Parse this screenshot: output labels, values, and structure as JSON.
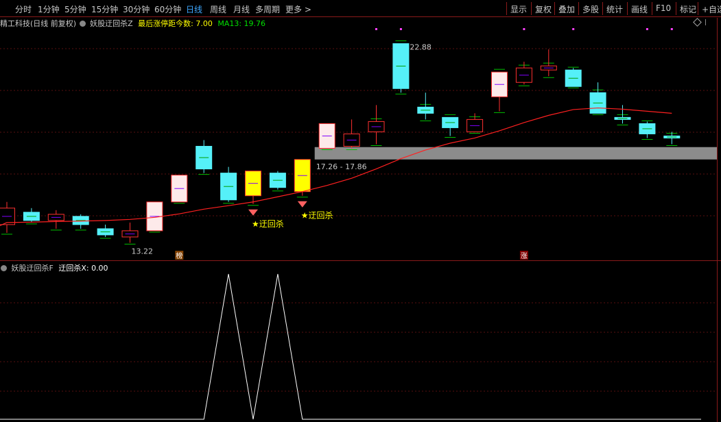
{
  "toolbar": {
    "periods": [
      "分时",
      "1分钟",
      "5分钟",
      "15分钟",
      "30分钟",
      "60分钟",
      "日线",
      "周线",
      "月线",
      "多周期",
      "更多 >"
    ],
    "active_period": "日线",
    "right_buttons": [
      "显示",
      "复权",
      "叠加",
      "多股",
      "统计",
      "画线",
      "F10",
      "标记",
      "+自选"
    ]
  },
  "main_panel": {
    "stock_title": "精工科技(日线 前复权)",
    "indicator_name": "妖股迂回杀Z",
    "last_limit_label": "最后涨停距今数: 7.00",
    "ma_label": "MA13: 19.76",
    "colors": {
      "ma13": "#ff2020",
      "indicator_name": "#c8c8c8",
      "last_limit": "#ffff00",
      "ma_label": "#00e000"
    }
  },
  "sub_panel": {
    "indicator_name": "妖股迂回杀F",
    "value_label": "迂回杀X: 0.00"
  },
  "chart_data": [
    {
      "type": "candlestick",
      "ma_name": "MA13",
      "ylim": [
        12.5,
        23.6
      ],
      "candles": [
        {
          "open": 14.1,
          "close": 14.9,
          "high": 15.2,
          "low": 13.7,
          "style": "hollow-red"
        },
        {
          "open": 14.7,
          "close": 14.3,
          "high": 14.9,
          "low": 14.2,
          "style": "cyan"
        },
        {
          "open": 14.3,
          "close": 14.6,
          "high": 14.8,
          "low": 13.9,
          "style": "hollow-red"
        },
        {
          "open": 14.5,
          "close": 14.1,
          "high": 14.6,
          "low": 13.9,
          "style": "cyan"
        },
        {
          "open": 13.9,
          "close": 13.6,
          "high": 14.1,
          "low": 13.5,
          "style": "cyan"
        },
        {
          "open": 13.5,
          "close": 13.8,
          "high": 14.2,
          "low": 13.22,
          "style": "hollow-red"
        },
        {
          "open": 13.8,
          "close": 15.2,
          "high": 15.2,
          "low": 13.8,
          "style": "pink-filled"
        },
        {
          "open": 15.2,
          "close": 16.5,
          "high": 16.5,
          "low": 15.2,
          "style": "pink-filled"
        },
        {
          "open": 17.9,
          "close": 16.8,
          "high": 18.2,
          "low": 16.6,
          "style": "cyan"
        },
        {
          "open": 16.6,
          "close": 15.3,
          "high": 16.9,
          "low": 15.2,
          "style": "cyan"
        },
        {
          "open": 15.5,
          "close": 16.7,
          "high": 16.7,
          "low": 15.1,
          "style": "yellow-filled"
        },
        {
          "open": 16.6,
          "close": 15.9,
          "high": 16.7,
          "low": 15.8,
          "style": "cyan"
        },
        {
          "open": 15.7,
          "close": 17.26,
          "high": 17.26,
          "low": 15.5,
          "style": "yellow-filled"
        },
        {
          "open": 17.8,
          "close": 19.0,
          "high": 19.0,
          "low": 17.8,
          "style": "pink-filled"
        },
        {
          "open": 17.9,
          "close": 18.5,
          "high": 19.2,
          "low": 17.8,
          "style": "hollow-red"
        },
        {
          "open": 18.6,
          "close": 19.1,
          "high": 19.9,
          "low": 18.0,
          "style": "hollow-red"
        },
        {
          "open": 20.7,
          "close": 22.88,
          "high": 22.88,
          "low": 20.5,
          "style": "cyan"
        },
        {
          "open": 19.8,
          "close": 19.5,
          "high": 20.5,
          "low": 19.2,
          "style": "cyan"
        },
        {
          "open": 19.3,
          "close": 18.8,
          "high": 19.3,
          "low": 18.4,
          "style": "cyan"
        },
        {
          "open": 18.6,
          "close": 19.2,
          "high": 19.5,
          "low": 18.6,
          "style": "hollow-red"
        },
        {
          "open": 20.3,
          "close": 21.5,
          "high": 21.5,
          "low": 19.6,
          "style": "pink-filled"
        },
        {
          "open": 21.0,
          "close": 21.7,
          "high": 22.0,
          "low": 20.9,
          "style": "hollow-red"
        },
        {
          "open": 21.6,
          "close": 21.8,
          "high": 22.6,
          "low": 21.3,
          "style": "hollow-red"
        },
        {
          "open": 21.6,
          "close": 20.8,
          "high": 21.7,
          "low": 20.8,
          "style": "cyan"
        },
        {
          "open": 20.5,
          "close": 19.5,
          "high": 21.0,
          "low": 19.5,
          "style": "cyan"
        },
        {
          "open": 19.3,
          "close": 19.2,
          "high": 19.9,
          "low": 19.0,
          "style": "cyan"
        },
        {
          "open": 19.0,
          "close": 18.5,
          "high": 19.1,
          "low": 18.3,
          "style": "cyan"
        },
        {
          "open": 18.4,
          "close": 18.3,
          "high": 18.6,
          "low": 18.0,
          "style": "cyan"
        }
      ],
      "ma13": [
        14.2,
        14.22,
        14.25,
        14.27,
        14.3,
        14.35,
        14.45,
        14.62,
        14.85,
        15.02,
        15.2,
        15.45,
        15.7,
        16.0,
        16.35,
        16.8,
        17.3,
        17.72,
        18.05,
        18.3,
        18.65,
        19.05,
        19.4,
        19.68,
        19.76,
        19.7,
        19.6,
        19.5
      ],
      "band": {
        "low": 17.26,
        "high": 17.86,
        "label": "17.26 - 17.86",
        "start_index": 13
      },
      "annotations": [
        {
          "index": 16,
          "text": "22.88"
        },
        {
          "index": 5,
          "text": "13.22"
        },
        {
          "index": 10,
          "text": "★迂回杀"
        },
        {
          "index": 12,
          "text": "★迂回杀"
        },
        {
          "index": 7,
          "text": "榜"
        },
        {
          "index": 21,
          "text": "涨"
        }
      ],
      "signal_indices": [
        10,
        12
      ],
      "magenta_marker_indices": [
        15,
        16,
        21,
        23,
        26,
        27
      ]
    },
    {
      "type": "line",
      "series": [
        {
          "name": "迂回杀X",
          "values": [
            0,
            0,
            0,
            0,
            0,
            0,
            0,
            0,
            0,
            1,
            0,
            1,
            0,
            0,
            0,
            0,
            0,
            0,
            0,
            0,
            0,
            0,
            0,
            0,
            0,
            0,
            0,
            0
          ]
        }
      ],
      "ylim": [
        0,
        1
      ]
    }
  ]
}
